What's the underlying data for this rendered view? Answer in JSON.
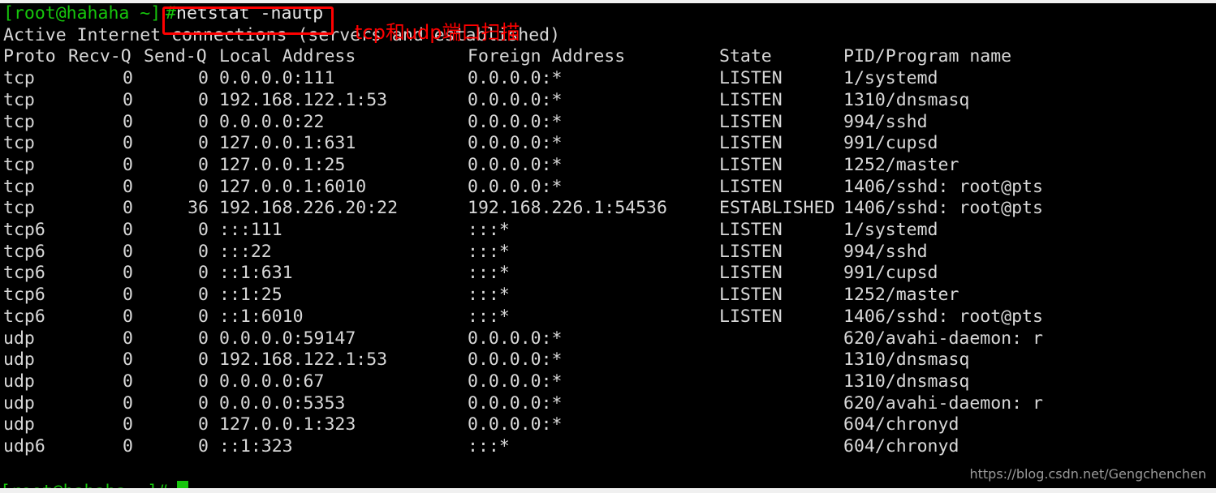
{
  "terminal": {
    "background_color": "#000000",
    "foreground_color": "#d8d8d8",
    "prompt_color": "#16c60c",
    "prompt": "[root@hahaha ~]",
    "prompt_symbol": "#",
    "command": "netstat -nautp",
    "banner": "Active Internet connections (servers and established)",
    "next_prompt": "[root@hahaha ~]#"
  },
  "annotation": {
    "text": "tcp和udp端口扫描",
    "color": "#ff0000",
    "box_color": "#ff0000"
  },
  "watermark": {
    "text": "https://blog.csdn.net/Gengchenchen"
  },
  "table": {
    "headers": {
      "proto": "Proto",
      "recvq": "Recv-Q",
      "sendq": "Send-Q",
      "local": "Local Address",
      "foreign": "Foreign Address",
      "state": "State",
      "pid": "PID/Program name"
    },
    "rows": [
      {
        "proto": "tcp",
        "recvq": "0",
        "sendq": "0",
        "local": "0.0.0.0:111",
        "foreign": "0.0.0.0:*",
        "state": "LISTEN",
        "pid": "1/systemd"
      },
      {
        "proto": "tcp",
        "recvq": "0",
        "sendq": "0",
        "local": "192.168.122.1:53",
        "foreign": "0.0.0.0:*",
        "state": "LISTEN",
        "pid": "1310/dnsmasq"
      },
      {
        "proto": "tcp",
        "recvq": "0",
        "sendq": "0",
        "local": "0.0.0.0:22",
        "foreign": "0.0.0.0:*",
        "state": "LISTEN",
        "pid": "994/sshd"
      },
      {
        "proto": "tcp",
        "recvq": "0",
        "sendq": "0",
        "local": "127.0.0.1:631",
        "foreign": "0.0.0.0:*",
        "state": "LISTEN",
        "pid": "991/cupsd"
      },
      {
        "proto": "tcp",
        "recvq": "0",
        "sendq": "0",
        "local": "127.0.0.1:25",
        "foreign": "0.0.0.0:*",
        "state": "LISTEN",
        "pid": "1252/master"
      },
      {
        "proto": "tcp",
        "recvq": "0",
        "sendq": "0",
        "local": "127.0.0.1:6010",
        "foreign": "0.0.0.0:*",
        "state": "LISTEN",
        "pid": "1406/sshd: root@pts"
      },
      {
        "proto": "tcp",
        "recvq": "0",
        "sendq": "36",
        "local": "192.168.226.20:22",
        "foreign": "192.168.226.1:54536",
        "state": "ESTABLISHED",
        "pid": "1406/sshd: root@pts"
      },
      {
        "proto": "tcp6",
        "recvq": "0",
        "sendq": "0",
        "local": ":::111",
        "foreign": ":::*",
        "state": "LISTEN",
        "pid": "1/systemd"
      },
      {
        "proto": "tcp6",
        "recvq": "0",
        "sendq": "0",
        "local": ":::22",
        "foreign": ":::*",
        "state": "LISTEN",
        "pid": "994/sshd"
      },
      {
        "proto": "tcp6",
        "recvq": "0",
        "sendq": "0",
        "local": "::1:631",
        "foreign": ":::*",
        "state": "LISTEN",
        "pid": "991/cupsd"
      },
      {
        "proto": "tcp6",
        "recvq": "0",
        "sendq": "0",
        "local": "::1:25",
        "foreign": ":::*",
        "state": "LISTEN",
        "pid": "1252/master"
      },
      {
        "proto": "tcp6",
        "recvq": "0",
        "sendq": "0",
        "local": "::1:6010",
        "foreign": ":::*",
        "state": "LISTEN",
        "pid": "1406/sshd: root@pts"
      },
      {
        "proto": "udp",
        "recvq": "0",
        "sendq": "0",
        "local": "0.0.0.0:59147",
        "foreign": "0.0.0.0:*",
        "state": "",
        "pid": "620/avahi-daemon: r"
      },
      {
        "proto": "udp",
        "recvq": "0",
        "sendq": "0",
        "local": "192.168.122.1:53",
        "foreign": "0.0.0.0:*",
        "state": "",
        "pid": "1310/dnsmasq"
      },
      {
        "proto": "udp",
        "recvq": "0",
        "sendq": "0",
        "local": "0.0.0.0:67",
        "foreign": "0.0.0.0:*",
        "state": "",
        "pid": "1310/dnsmasq"
      },
      {
        "proto": "udp",
        "recvq": "0",
        "sendq": "0",
        "local": "0.0.0.0:5353",
        "foreign": "0.0.0.0:*",
        "state": "",
        "pid": "620/avahi-daemon: r"
      },
      {
        "proto": "udp",
        "recvq": "0",
        "sendq": "0",
        "local": "127.0.0.1:323",
        "foreign": "0.0.0.0:*",
        "state": "",
        "pid": "604/chronyd"
      },
      {
        "proto": "udp6",
        "recvq": "0",
        "sendq": "0",
        "local": "::1:323",
        "foreign": ":::*",
        "state": "",
        "pid": "604/chronyd"
      }
    ]
  }
}
